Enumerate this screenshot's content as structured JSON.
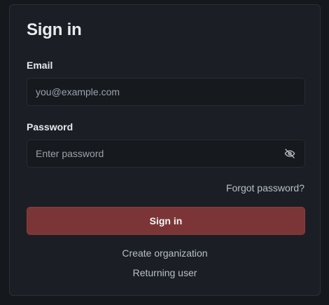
{
  "signin": {
    "title": "Sign in",
    "email": {
      "label": "Email",
      "placeholder": "you@example.com",
      "value": ""
    },
    "password": {
      "label": "Password",
      "placeholder": "Enter password",
      "value": "",
      "toggle_icon": "eye-off-icon"
    },
    "forgot_label": "Forgot password?",
    "submit_label": "Sign in",
    "create_org_label": "Create organization",
    "returning_user_label": "Returning user"
  },
  "colors": {
    "background": "#15181d",
    "card": "#1b1f25",
    "primary_button": "#7c3536",
    "muted_text": "#b9bfc7"
  }
}
